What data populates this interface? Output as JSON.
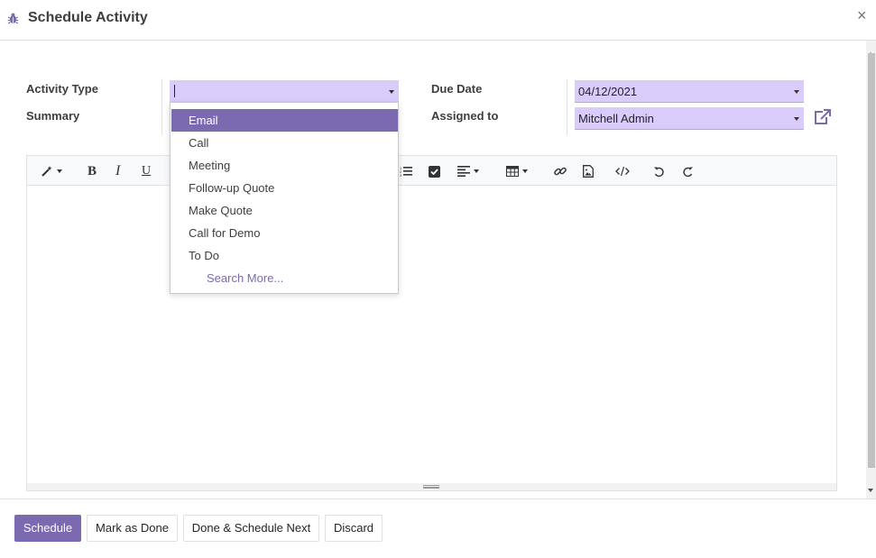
{
  "dialog": {
    "title": "Schedule Activity",
    "close_label": "×"
  },
  "form": {
    "activity_type_label": "Activity Type",
    "activity_type_value": "",
    "summary_label": "Summary",
    "due_date_label": "Due Date",
    "due_date_value": "04/12/2021",
    "assigned_to_label": "Assigned to",
    "assigned_to_value": "Mitchell Admin"
  },
  "dropdown": {
    "items": [
      "Email",
      "Call",
      "Meeting",
      "Follow-up Quote",
      "Make Quote",
      "Call for Demo",
      "To Do"
    ],
    "active_item": "Email",
    "search_more": "Search More..."
  },
  "toolbar": {
    "bold": "B",
    "italic": "I",
    "underline": "U"
  },
  "footer": {
    "schedule": "Schedule",
    "mark_done": "Mark as Done",
    "done_next": "Done & Schedule Next",
    "discard": "Discard"
  },
  "colors": {
    "accent": "#7c6ab0",
    "field_bg": "#d9cbfa"
  }
}
